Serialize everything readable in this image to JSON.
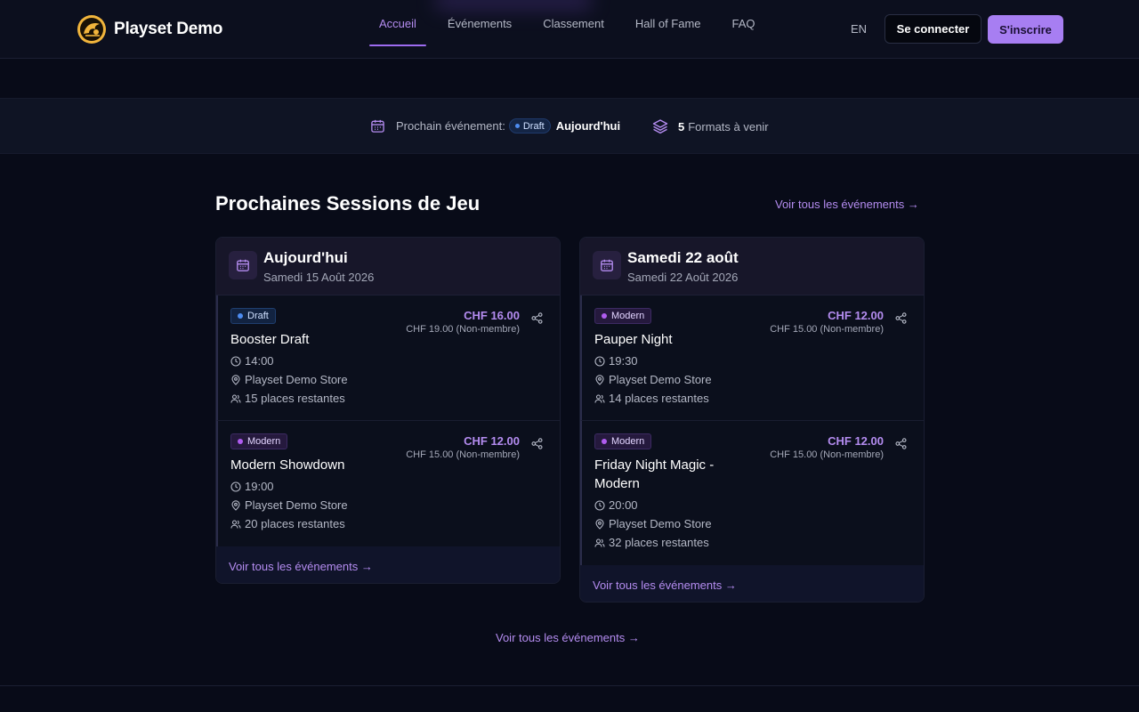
{
  "header": {
    "brand": "Playset Demo",
    "nav": [
      "Accueil",
      "Événements",
      "Classement",
      "Hall of Fame",
      "FAQ"
    ],
    "active_nav": "Accueil",
    "lang": "EN",
    "login": "Se connecter",
    "signup": "S'inscrire"
  },
  "strip": {
    "next_label": "Prochain événement:",
    "next_badge": "Draft",
    "next_when": "Aujourd'hui",
    "formats_count": "5",
    "formats_label": "Formats à venir"
  },
  "section": {
    "title": "Prochaines Sessions de Jeu",
    "see_all": "Voir tous les événements →",
    "see_all_card": "Voir tous les événements →",
    "see_all_bottom": "Voir tous les événements →"
  },
  "cards": [
    {
      "title": "Aujourd'hui",
      "subtitle": "Samedi 15 Août 2026",
      "events": [
        {
          "badge": "Draft",
          "name": "Booster Draft",
          "price": "CHF 16.00",
          "price_nm": "CHF 19.00 (Non-membre)",
          "time": "14:00",
          "store": "Playset Demo Store",
          "places": "15 places restantes"
        },
        {
          "badge": "Modern",
          "name": "Modern Showdown",
          "price": "CHF 12.00",
          "price_nm": "CHF 15.00 (Non-membre)",
          "time": "19:00",
          "store": "Playset Demo Store",
          "places": "20 places restantes"
        }
      ]
    },
    {
      "title": "Samedi 22 août",
      "subtitle": "Samedi 22 Août 2026",
      "events": [
        {
          "badge": "Modern",
          "name": "Pauper Night",
          "price": "CHF 12.00",
          "price_nm": "CHF 15.00 (Non-membre)",
          "time": "19:30",
          "store": "Playset Demo Store",
          "places": "14 places restantes"
        },
        {
          "badge": "Modern",
          "name": "Friday Night Magic - Modern",
          "price": "CHF 12.00",
          "price_nm": "CHF 15.00 (Non-membre)",
          "time": "20:00",
          "store": "Playset Demo Store",
          "places": "32 places restantes"
        }
      ]
    }
  ],
  "colors": {
    "accent": "#a77ef2",
    "background": "#080b18",
    "draft": "#4d8cf0",
    "modern": "#b05cf0"
  }
}
